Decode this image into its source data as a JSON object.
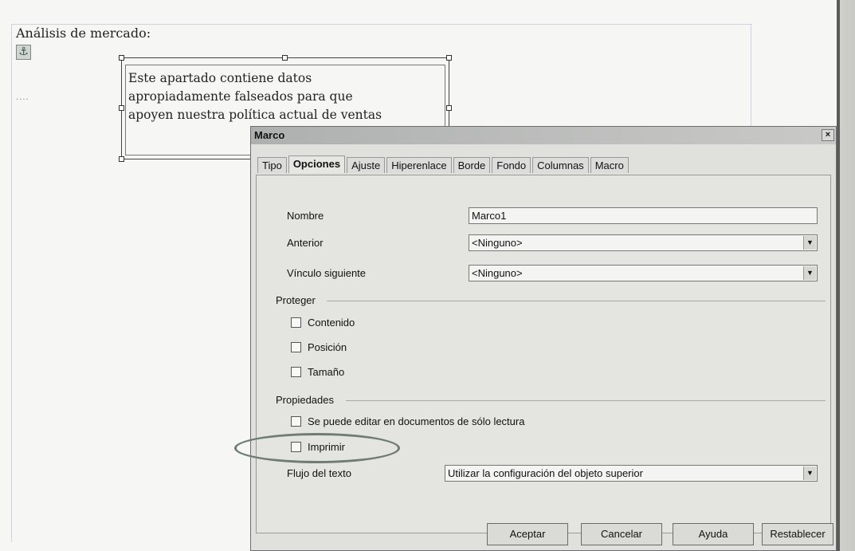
{
  "document": {
    "heading": "Análisis de mercado:",
    "anchor_icon": "anchor-icon",
    "frame_text_lines": [
      "Este apartado contiene datos",
      "apropiadamente falseados para que",
      "apoyen nuestra política actual de ventas"
    ],
    "dots": "····"
  },
  "dialog": {
    "title": "Marco",
    "close_label": "×",
    "tabs": [
      {
        "label": "Tipo",
        "active": false
      },
      {
        "label": "Opciones",
        "active": true
      },
      {
        "label": "Ajuste",
        "active": false
      },
      {
        "label": "Hiperenlace",
        "active": false
      },
      {
        "label": "Borde",
        "active": false
      },
      {
        "label": "Fondo",
        "active": false
      },
      {
        "label": "Columnas",
        "active": false
      },
      {
        "label": "Macro",
        "active": false
      }
    ],
    "fields": {
      "nombre": {
        "label": "Nombre",
        "value": "Marco1"
      },
      "anterior": {
        "label": "Anterior",
        "value": "<Ninguno>"
      },
      "vinculo": {
        "label": "Vínculo siguiente",
        "value": "<Ninguno>"
      }
    },
    "proteger": {
      "title": "Proteger",
      "items": [
        "Contenido",
        "Posición",
        "Tamaño"
      ]
    },
    "propiedades": {
      "title": "Propiedades",
      "editar_label": "Se puede editar en documentos de sólo lectura",
      "imprimir_label": "Imprimir",
      "flujo_label": "Flujo del texto",
      "flujo_value": "Utilizar la configuración del objeto superior"
    },
    "buttons": {
      "aceptar": "Aceptar",
      "cancelar": "Cancelar",
      "ayuda": "Ayuda",
      "restablecer": "Restablecer"
    }
  },
  "colors": {
    "dialog_bg": "#e0e0dd",
    "highlight_ellipse": "#6e7c73"
  }
}
